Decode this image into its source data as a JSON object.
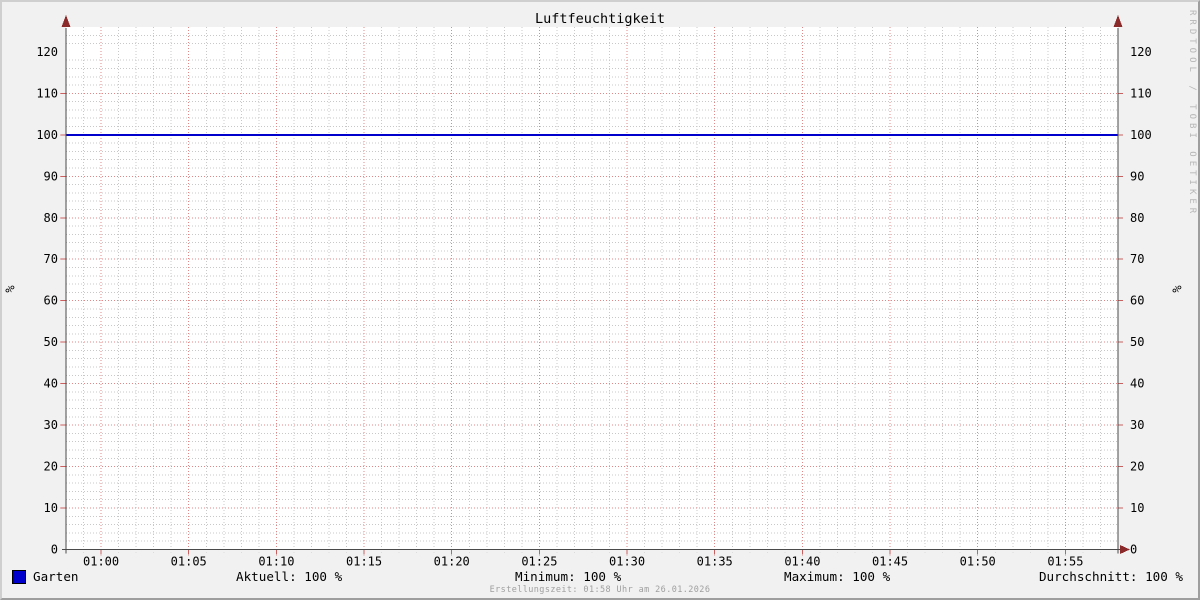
{
  "window": {
    "background": "#f1f1f1",
    "bevel_light": "#cfcfcf",
    "bevel_dark": "#9e9e9e"
  },
  "chart_data": {
    "type": "line",
    "title": "Luftfeuchtigkeit",
    "ylabel": "%",
    "ylabel_right": "%",
    "ylim": [
      0,
      126
    ],
    "y_tick_labels": [
      0,
      10,
      20,
      30,
      40,
      50,
      60,
      70,
      80,
      90,
      100,
      110,
      120
    ],
    "y_major_step": 10,
    "y_minor_step": 2,
    "x_axis": {
      "start": "00:58",
      "end": "01:58",
      "major_step_min": 5,
      "minor_step_min": 1,
      "tick_labels": [
        "01:00",
        "01:05",
        "01:10",
        "01:15",
        "01:20",
        "01:25",
        "01:30",
        "01:35",
        "01:40",
        "01:45",
        "01:50",
        "01:55"
      ]
    },
    "series": [
      {
        "name": "Garten",
        "color": "#0000cc",
        "constant_value": 100,
        "points": [
          {
            "t": "00:58",
            "v": 100
          },
          {
            "t": "01:58",
            "v": 100
          }
        ]
      }
    ],
    "grid": {
      "canvas": "#ffffff",
      "minor_color": "#c8c8c8",
      "major_color": "#e08888",
      "axis_color": "#4a4a4a",
      "arrow_color": "#8b2a2a"
    }
  },
  "legend": {
    "series_label": "Garten",
    "swatch_style": "background-color:#0000cc",
    "stats": [
      {
        "label": "Aktuell: 100 %"
      },
      {
        "label": "Minimum: 100 %"
      },
      {
        "label": "Maximum: 100 %"
      },
      {
        "label": "Durchschnitt: 100 %"
      }
    ]
  },
  "footer": {
    "text": "Erstellungszeit: 01:58 Uhr am 26.01.2026"
  },
  "watermark": "RRDTOOL / TOBI OETIKER"
}
